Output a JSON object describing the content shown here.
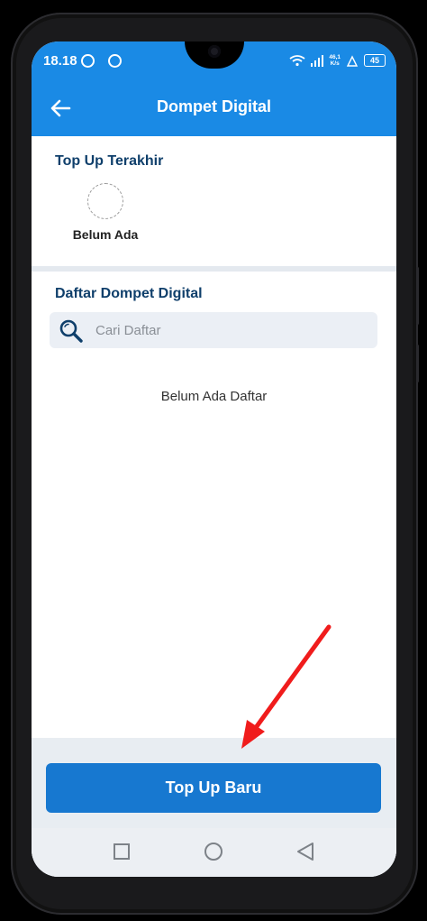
{
  "status_bar": {
    "time": "18.18",
    "speed_value": "46,1",
    "speed_unit": "K/s",
    "battery": "45",
    "icons": [
      "ring-icon",
      "ring-icon",
      "wifi-icon",
      "signal-icon",
      "cell-signal-icon",
      "battery-icon"
    ]
  },
  "app_bar": {
    "title": "Dompet Digital",
    "back_icon": "arrow-left-icon"
  },
  "recent_topup": {
    "title": "Top Up Terakhir",
    "empty_label": "Belum Ada"
  },
  "wallet_list": {
    "title": "Daftar Dompet Digital",
    "search_placeholder": "Cari Daftar",
    "empty_text": "Belum Ada Daftar"
  },
  "cta": {
    "label": "Top Up Baru"
  },
  "nav": {
    "icons": [
      "recent-apps-icon",
      "home-icon",
      "back-icon"
    ]
  },
  "colors": {
    "app_bar": "#1a8ae5",
    "section_title": "#0f3f6b",
    "cta": "#1778d0",
    "annotation_arrow": "#f01c1c"
  }
}
